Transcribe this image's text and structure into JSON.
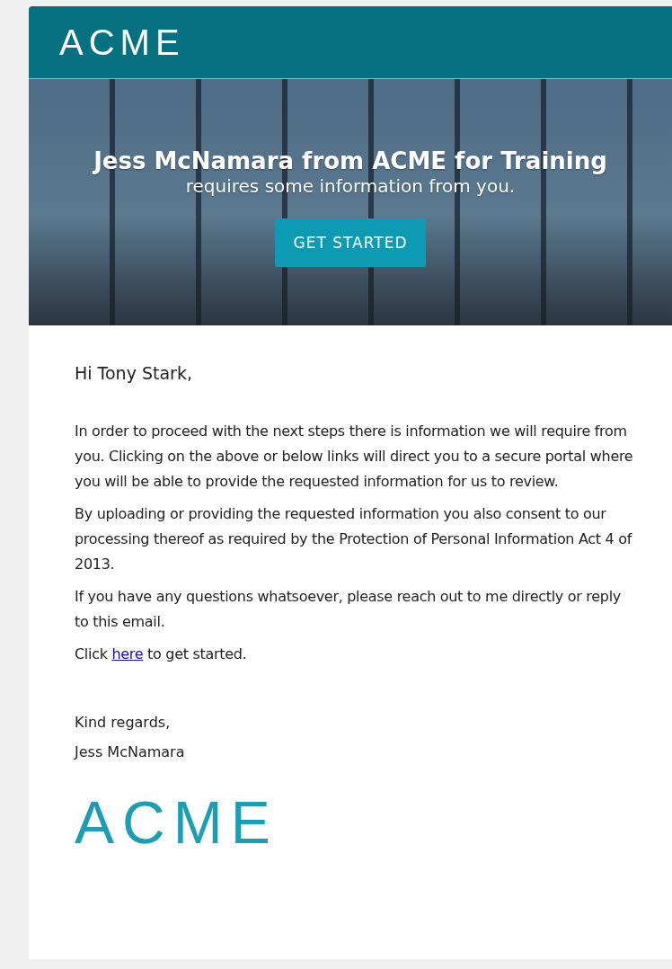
{
  "header": {
    "logo": "ACME"
  },
  "hero": {
    "title": "Jess McNamara from ACME for Training",
    "subtitle": "requires some information from you.",
    "button": "GET STARTED"
  },
  "body": {
    "greeting": "Hi Tony Stark,",
    "paragraphs": [
      {
        "kind": "text",
        "text": "In order to proceed with the next steps there is information we will require from you. Clicking on the above or below links will direct you to a secure portal where you will be able to provide the requested information for us to review."
      },
      {
        "kind": "text",
        "text": "By uploading or providing the requested information you also consent to our processing thereof as required by the Protection of Personal Information Act 4 of 2013."
      },
      {
        "kind": "text",
        "text": "If you have any questions whatsoever, please reach out to me directly or reply to this email."
      },
      {
        "kind": "link",
        "before": "Click ",
        "link": "here",
        "after": " to get started."
      }
    ],
    "closing": "Kind regards,",
    "signature": "Jess McNamara",
    "footer_logo": "ACME"
  }
}
